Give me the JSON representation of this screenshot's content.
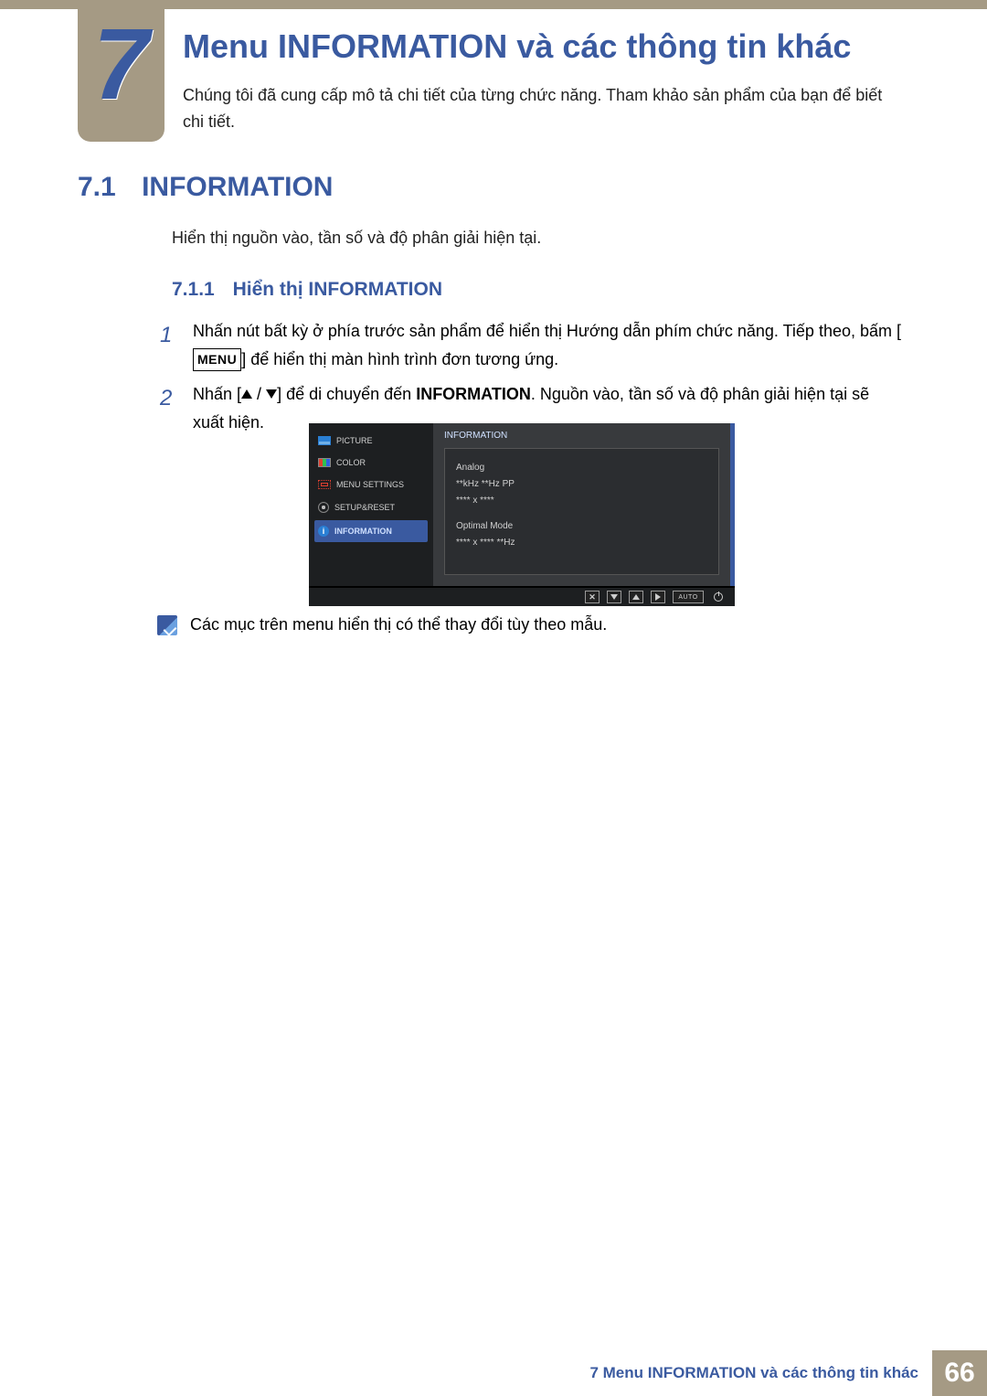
{
  "chapter": {
    "number": "7",
    "title": "Menu INFORMATION và các thông tin khác"
  },
  "intro": "Chúng tôi đã cung cấp mô tả chi tiết của từng chức năng. Tham khảo sản phẩm của bạn để biết chi tiết.",
  "section": {
    "number": "7.1",
    "title": "INFORMATION",
    "desc": "Hiển thị nguồn vào, tần số và độ phân giải hiện tại."
  },
  "subsection": {
    "number": "7.1.1",
    "title": "Hiển thị INFORMATION"
  },
  "steps": {
    "s1a": "Nhấn nút bất kỳ ở phía trước sản phẩm để hiển thị Hướng dẫn phím chức năng. Tiếp theo, bấm",
    "s1_menu": "MENU",
    "s1b": "để hiển thị màn hình trình đơn tương ứng.",
    "s2a": "Nhấn [",
    "s2b": "] để di chuyển đến ",
    "s2_target": "INFORMATION",
    "s2c": ". Nguồn vào, tần số và độ phân giải hiện tại sẽ xuất hiện."
  },
  "osd": {
    "menu": {
      "picture": "PICTURE",
      "color": "COLOR",
      "settings": "MENU SETTINGS",
      "setup": "SETUP&RESET",
      "information": "INFORMATION"
    },
    "panel": {
      "title": "INFORMATION",
      "line1": "Analog",
      "line2": "**kHz **Hz PP",
      "line3": "**** x ****",
      "line4": "Optimal Mode",
      "line5": "**** x **** **Hz"
    },
    "bar": {
      "auto": "AUTO"
    },
    "info_glyph": "i"
  },
  "note": "Các mục trên menu hiển thị có thể thay đổi tùy theo mẫu.",
  "footer": {
    "label": "7 Menu INFORMATION và các thông tin khác",
    "page": "66"
  }
}
